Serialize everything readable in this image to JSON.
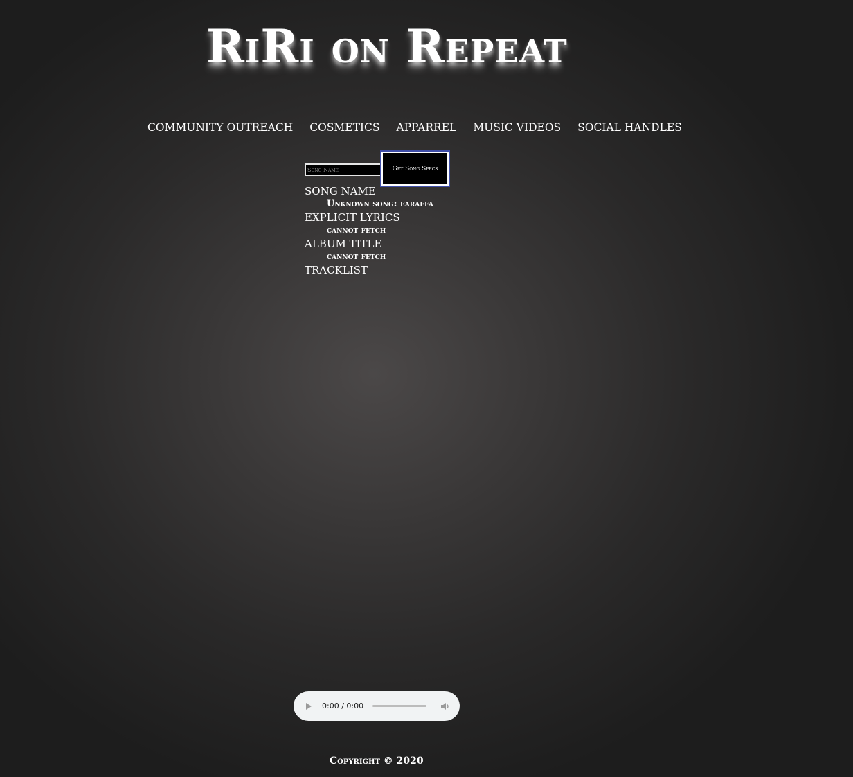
{
  "header": {
    "title": "RiRi on Repeat"
  },
  "nav": {
    "items": [
      {
        "label": "COMMUNITY OUTREACH"
      },
      {
        "label": "COSMETICS"
      },
      {
        "label": "APPARREL"
      },
      {
        "label": "MUSIC VIDEOS"
      },
      {
        "label": "SOCIAL HANDLES"
      }
    ]
  },
  "search": {
    "placeholder": "Song Name",
    "value": "",
    "button_label": "Get Song Specs"
  },
  "specs": {
    "song_name_label": "SONG NAME",
    "song_name_value": "Unknown song: earaefa",
    "explicit_label": "EXPLICIT LYRICS",
    "explicit_value": "cannot fetch",
    "album_label": "ALBUM TITLE",
    "album_value": "cannot fetch",
    "tracklist_label": "TRACKLIST"
  },
  "player": {
    "time": "0:00 / 0:00",
    "progress": 0,
    "play_icon": "play-icon",
    "volume_icon": "volume-icon"
  },
  "footer": {
    "copyright": "Copyright © 2020"
  },
  "colors": {
    "background_center": "#4b4848",
    "background_edge": "#1d1d1d",
    "text": "#ffffff",
    "button_focus_ring": "#3f4ea8",
    "player_background": "#f1f3f4"
  }
}
